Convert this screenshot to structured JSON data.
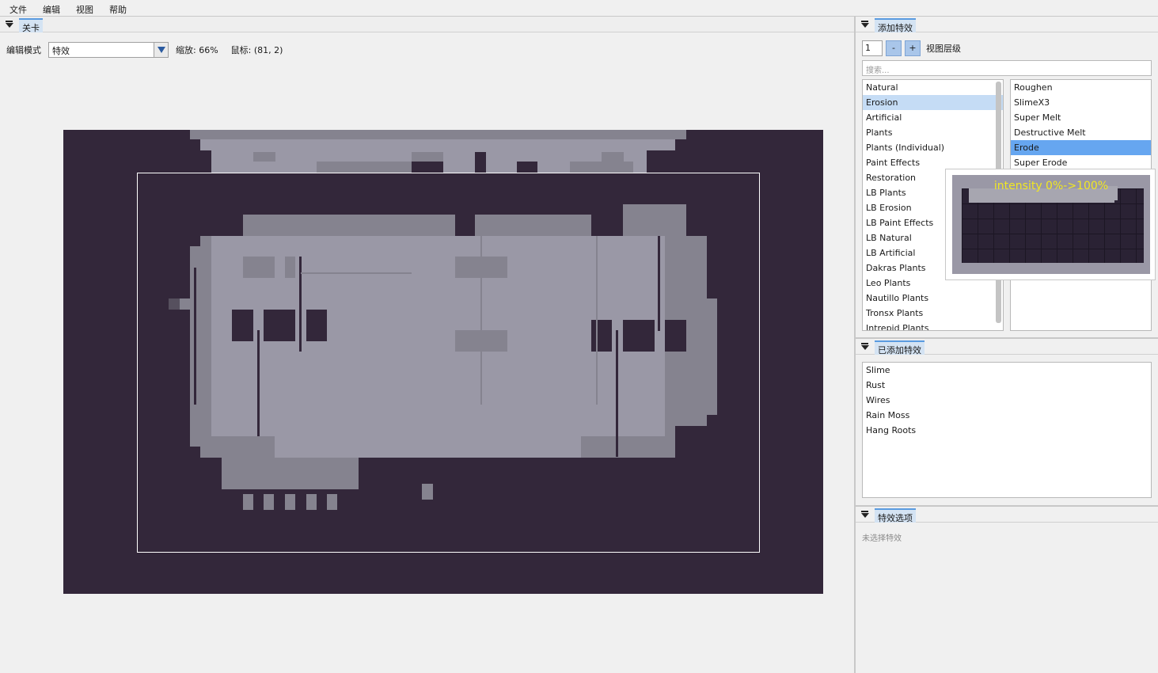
{
  "menubar": {
    "items": [
      "文件",
      "编辑",
      "视图",
      "帮助"
    ]
  },
  "left": {
    "tab": "关卡",
    "mode_label": "编辑模式",
    "mode_value": "特效",
    "zoom": "缩放: 66%",
    "mouse": "鼠标: (81, 2)"
  },
  "right": {
    "add_effect_tab": "添加特效",
    "layer_value": "1",
    "minus_label": "-",
    "plus_label": "+",
    "layer_label": "视图层级",
    "search_placeholder": "搜索...",
    "categories": [
      "Natural",
      "Erosion",
      "Artificial",
      "Plants",
      "Plants (Individual)",
      "Paint Effects",
      "Restoration",
      "LB Plants",
      "LB Erosion",
      "LB Paint Effects",
      "LB Natural",
      "LB Artificial",
      "Dakras Plants",
      "Leo Plants",
      "Nautillo Plants",
      "Tronsx Plants",
      "Intrepid Plants"
    ],
    "selected_category": "Erosion",
    "effects": [
      "Roughen",
      "SlimeX3",
      "Super Melt",
      "Destructive Melt",
      "Erode",
      "Super Erode"
    ],
    "selected_effect": "Erode",
    "preview_caption": "intensity 0%->100%",
    "added_tab": "已添加特效",
    "added_effects": [
      "Slime",
      "Rust",
      "Wires",
      "Rain Moss",
      "Hang Roots"
    ],
    "options_tab": "特效选项",
    "options_placeholder": "未选择特效"
  },
  "colors": {
    "canvas_bg": "#33273a",
    "level_light": "#9a98a6",
    "level_mid": "#85838f",
    "accent": "#66a6f0"
  }
}
